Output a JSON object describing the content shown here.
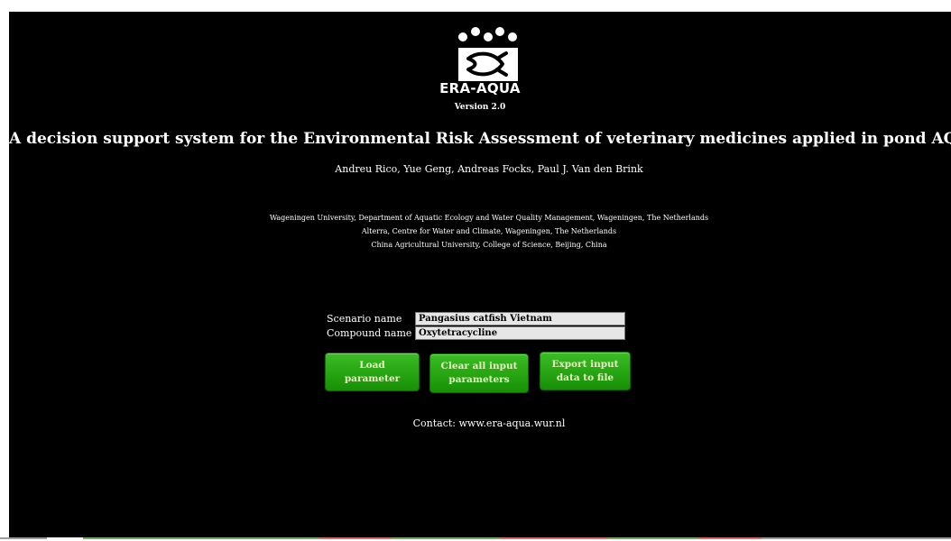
{
  "logo": {
    "icon": "fish-logo-icon",
    "text": "ERA-AQUA"
  },
  "version": "Version 2.0",
  "title": "A decision support system for the Environmental Risk Assessment of veterinary medicines applied in pond AQUAculture",
  "authors": "Andreu Rico, Yue Geng, Andreas Focks, Paul J. Van den Brink",
  "affiliations": [
    "Wageningen University, Department of Aquatic Ecology and Water Quality Management, Wageningen, The Netherlands",
    "Alterra, Centre for Water and Climate, Wageningen, The Netherlands",
    "China Agricultural University, College of Science,  Beijing, China"
  ],
  "form": {
    "scenario": {
      "label": "Scenario name",
      "value": "Pangasius catfish Vietnam"
    },
    "compound": {
      "label": "Compound name",
      "value": "Oxytetracycline"
    }
  },
  "buttons": {
    "load": "Load\nparameter",
    "clear": "Clear all input\nparameters",
    "export": "Export input\ndata to file"
  },
  "contact": "Contact: www.era-aqua.wur.nl",
  "colors": {
    "background": "#000000",
    "button_green": "#2aa915",
    "button_text": "#e8f3c4",
    "input_bg": "#e6e6e6"
  }
}
